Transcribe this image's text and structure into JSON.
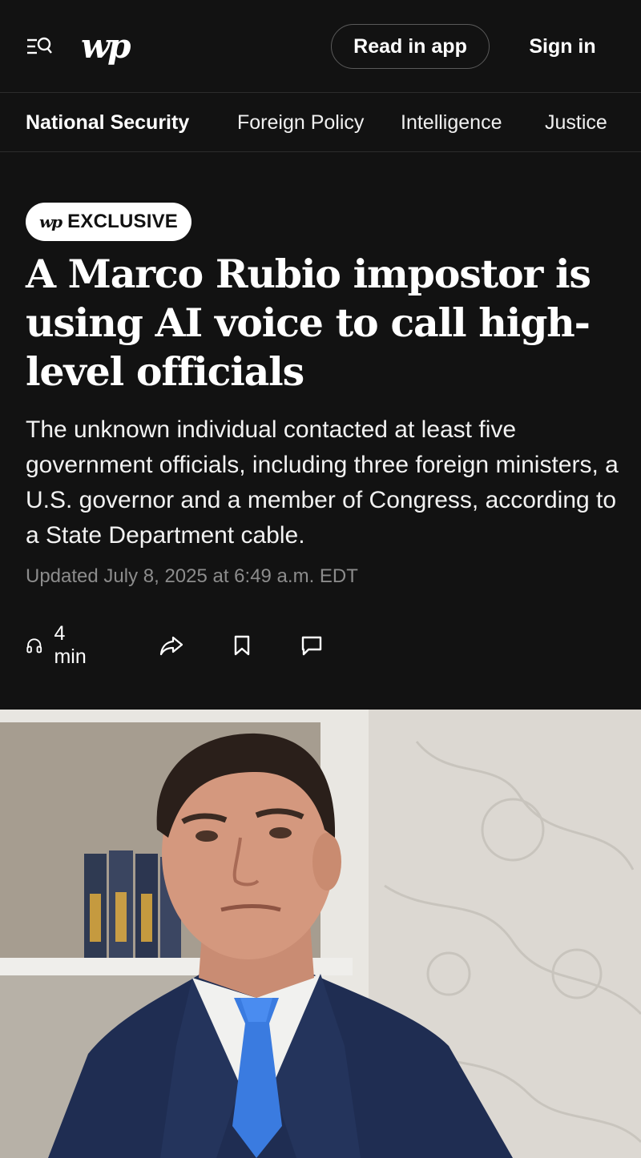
{
  "header": {
    "logo": "wp",
    "read_in_app": "Read in app",
    "sign_in": "Sign in"
  },
  "nav": {
    "items": [
      {
        "label": "National Security",
        "active": true
      },
      {
        "label": "Foreign Policy",
        "active": false
      },
      {
        "label": "Intelligence",
        "active": false
      },
      {
        "label": "Justice",
        "active": false
      }
    ]
  },
  "article": {
    "badge_logo": "wp",
    "badge_label": "EXCLUSIVE",
    "headline": "A Marco Rubio impostor is using AI voice to call high-level officials",
    "dek": "The unknown individual contacted at least five government officials, including three foreign ministers, a U.S. governor and a member of Congress, according to a State Department cable.",
    "timestamp": "Updated July 8, 2025 at 6:49 a.m. EDT",
    "listen_duration": "4 min"
  },
  "colors": {
    "background": "#121212",
    "text": "#ffffff",
    "muted": "#8c8c8c",
    "tie": "#3a7be0",
    "suit": "#1f2d52"
  }
}
